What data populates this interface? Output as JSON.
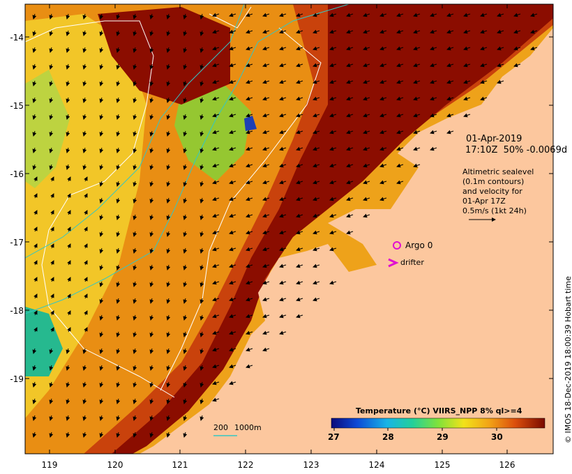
{
  "map": {
    "lon_ticks": [
      "119",
      "120",
      "121",
      "122",
      "123",
      "124",
      "125",
      "126"
    ],
    "lat_ticks": [
      "-14",
      "-15",
      "-16",
      "-17",
      "-18",
      "-19"
    ],
    "colors": {
      "land": "#fcc79e",
      "sst_darkest": "#8b0d00",
      "sst_dark": "#c63a0a",
      "sst_mid": "#e8920c",
      "sst_light": "#f2c622",
      "cool_green": "#8fd94a",
      "teal": "#25b98f",
      "cold_blue": "#1e3fb6",
      "contour_white": "#ffffff",
      "contour_cyan": "#33c7c4",
      "argo": "#e010d0"
    }
  },
  "annotation": {
    "date": "01-Apr-2019",
    "time_line": "17:10Z  50% -0.0069d",
    "alt_lines": [
      "Altimetric sealevel",
      "(0.1m contours)",
      "and velocity for",
      "01-Apr 17Z",
      "0.5m/s (1kt 24h)"
    ]
  },
  "argo_label": "Argo 0",
  "drifter_label": "drifter",
  "depth_legend": {
    "v200": "200",
    "v1000": "1000m"
  },
  "colorbar": {
    "title": "Temperature (°C) VIIRS_NPP 8% ql>=4",
    "ticks": [
      "27",
      "28",
      "29",
      "30"
    ]
  },
  "credit": "© IMOS 18-Dec-2019 18:00:39 Hobart time"
}
